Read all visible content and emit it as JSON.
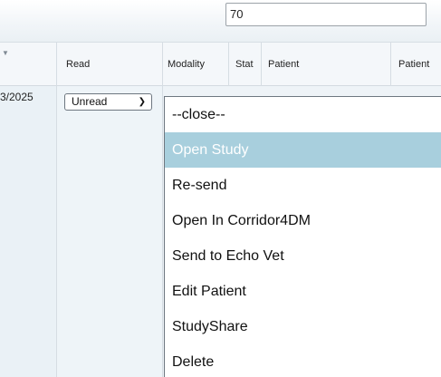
{
  "search": {
    "value": "70"
  },
  "table": {
    "headers": [
      "Read",
      "Modality",
      "Stat",
      "Patient",
      "Patient"
    ],
    "row": {
      "date_partial": "3/2025",
      "read_selected": "Unread"
    }
  },
  "menu": {
    "items": [
      "--close--",
      "Open Study",
      "Re-send",
      "Open In Corridor4DM",
      "Send to Echo Vet",
      "Edit Patient",
      "StudyShare",
      "Delete"
    ],
    "active_index": 1
  },
  "icons": {
    "sort": "sort-caret-icon",
    "dropdown": "chevron-down-icon"
  },
  "colors": {
    "menu_highlight": "#a8cfdd",
    "header_bg": "#f4f7fa",
    "body_bg": "#eef3f7"
  }
}
